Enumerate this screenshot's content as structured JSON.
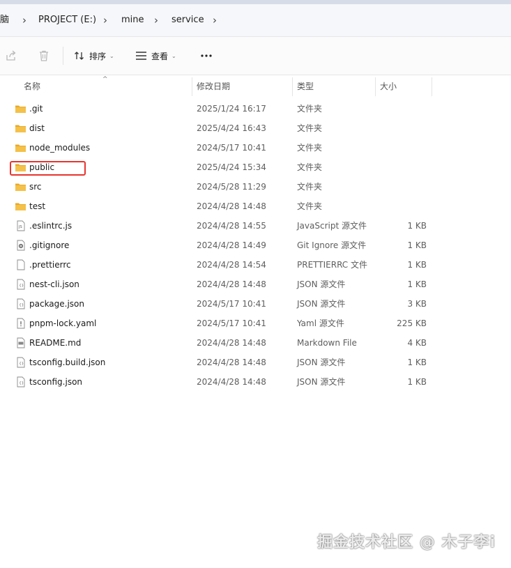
{
  "breadcrumb": {
    "items": [
      {
        "label": "脑"
      },
      {
        "label": "PROJECT (E:)"
      },
      {
        "label": "mine"
      },
      {
        "label": "service"
      }
    ],
    "separator": "›"
  },
  "toolbar": {
    "share_icon": "share-icon",
    "delete_icon": "trash-icon",
    "sort_label": "排序",
    "view_label": "查看",
    "more_label": "···"
  },
  "columns": {
    "name": "名称",
    "modified": "修改日期",
    "type": "类型",
    "size": "大小"
  },
  "files": [
    {
      "name": ".git",
      "modified": "2025/1/24 16:17",
      "type": "文件夹",
      "size": "",
      "icon": "folder-icon"
    },
    {
      "name": "dist",
      "modified": "2025/4/24 16:43",
      "type": "文件夹",
      "size": "",
      "icon": "folder-icon"
    },
    {
      "name": "node_modules",
      "modified": "2024/5/17 10:41",
      "type": "文件夹",
      "size": "",
      "icon": "folder-icon"
    },
    {
      "name": "public",
      "modified": "2025/4/24 15:34",
      "type": "文件夹",
      "size": "",
      "icon": "folder-icon"
    },
    {
      "name": "src",
      "modified": "2024/5/28 11:29",
      "type": "文件夹",
      "size": "",
      "icon": "folder-icon"
    },
    {
      "name": "test",
      "modified": "2024/4/28 14:48",
      "type": "文件夹",
      "size": "",
      "icon": "folder-icon"
    },
    {
      "name": ".eslintrc.js",
      "modified": "2024/4/28 14:55",
      "type": "JavaScript 源文件",
      "size": "1 KB",
      "icon": "js-file-icon"
    },
    {
      "name": ".gitignore",
      "modified": "2024/4/28 14:49",
      "type": "Git Ignore 源文件",
      "size": "1 KB",
      "icon": "gear-file-icon"
    },
    {
      "name": ".prettierrc",
      "modified": "2024/4/28 14:54",
      "type": "PRETTIERRC 文件",
      "size": "1 KB",
      "icon": "blank-file-icon"
    },
    {
      "name": "nest-cli.json",
      "modified": "2024/4/28 14:48",
      "type": "JSON 源文件",
      "size": "1 KB",
      "icon": "json-file-icon"
    },
    {
      "name": "package.json",
      "modified": "2024/5/17 10:41",
      "type": "JSON 源文件",
      "size": "3 KB",
      "icon": "json-file-icon"
    },
    {
      "name": "pnpm-lock.yaml",
      "modified": "2024/5/17 10:41",
      "type": "Yaml 源文件",
      "size": "225 KB",
      "icon": "yaml-file-icon"
    },
    {
      "name": "README.md",
      "modified": "2024/4/28 14:48",
      "type": "Markdown File",
      "size": "4 KB",
      "icon": "md-file-icon"
    },
    {
      "name": "tsconfig.build.json",
      "modified": "2024/4/28 14:48",
      "type": "JSON 源文件",
      "size": "1 KB",
      "icon": "json-file-icon"
    },
    {
      "name": "tsconfig.json",
      "modified": "2024/4/28 14:48",
      "type": "JSON 源文件",
      "size": "1 KB",
      "icon": "json-file-icon"
    }
  ],
  "highlighted_item": "public",
  "watermark": "掘金技术社区 @ 木子李i",
  "colors": {
    "folder": "#f4c14a",
    "folder_tab": "#e9a926",
    "highlight": "#e8342f",
    "breadcrumb_bg": "#f6f7fa"
  }
}
